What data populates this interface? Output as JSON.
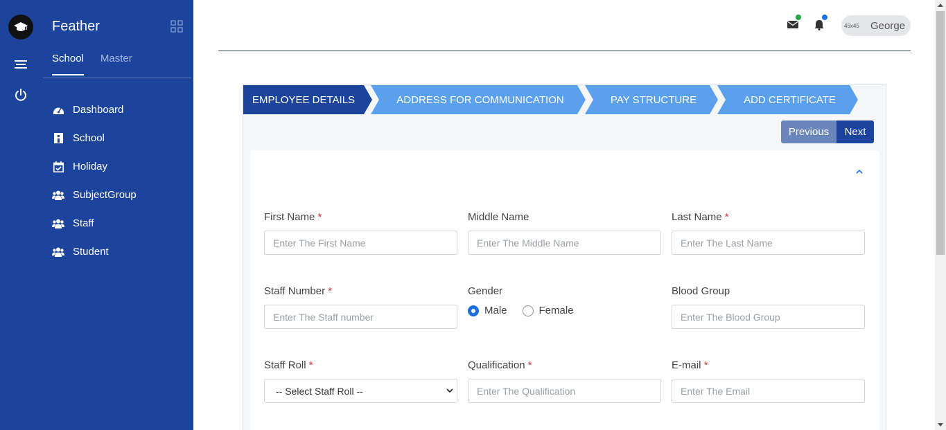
{
  "app": {
    "brand": "Feather"
  },
  "sidebar": {
    "tabs": [
      {
        "label": "School",
        "active": true
      },
      {
        "label": "Master",
        "active": false
      }
    ],
    "items": [
      {
        "label": "Dashboard",
        "icon": "dashboard-icon"
      },
      {
        "label": "School",
        "icon": "school-icon"
      },
      {
        "label": "Holiday",
        "icon": "calendar-check-icon"
      },
      {
        "label": "SubjectGroup",
        "icon": "users-icon"
      },
      {
        "label": "Staff",
        "icon": "users-icon"
      },
      {
        "label": "Student",
        "icon": "users-icon"
      }
    ],
    "rail_icons": [
      "graduation-cap-icon",
      "menu-icon",
      "power-icon"
    ]
  },
  "header": {
    "avatar_placeholder": "45x45",
    "user_name": "George",
    "mail_dot_color": "#28a745",
    "bell_dot_color": "#1a73e8"
  },
  "wizard": {
    "steps": [
      {
        "label": "EMPLOYEE DETAILS",
        "active": true
      },
      {
        "label": "ADDRESS FOR COMMUNICATION",
        "active": false
      },
      {
        "label": "PAY STRUCTURE",
        "active": false
      },
      {
        "label": "ADD CERTIFICATE",
        "active": false
      }
    ],
    "previous_label": "Previous",
    "next_label": "Next"
  },
  "form": {
    "first_name": {
      "label": "First Name",
      "required": "*",
      "placeholder": "Enter The First Name",
      "value": ""
    },
    "middle_name": {
      "label": "Middle Name",
      "placeholder": "Enter The Middle Name",
      "value": ""
    },
    "last_name": {
      "label": "Last Name",
      "required": "*",
      "placeholder": "Enter The Last Name",
      "value": ""
    },
    "staff_number": {
      "label": "Staff Number",
      "required": "*",
      "placeholder": "Enter The Staff number",
      "value": ""
    },
    "gender": {
      "label": "Gender",
      "options": [
        "Male",
        "Female"
      ],
      "selected": "Male"
    },
    "blood_group": {
      "label": "Blood Group",
      "placeholder": "Enter The Blood Group",
      "value": ""
    },
    "staff_roll": {
      "label": "Staff Roll",
      "required": "*",
      "selected": "-- Select Staff Roll --"
    },
    "qualification": {
      "label": "Qualification",
      "required": "*",
      "placeholder": "Enter The Qualification",
      "value": ""
    },
    "email": {
      "label": "E-mail",
      "required": "*",
      "placeholder": "Enter The Email",
      "value": ""
    }
  },
  "colors": {
    "sidebar_bg": "#1c449c",
    "step_active": "#1c449c",
    "step_inactive": "#5aa0ec",
    "required": "#d33"
  }
}
